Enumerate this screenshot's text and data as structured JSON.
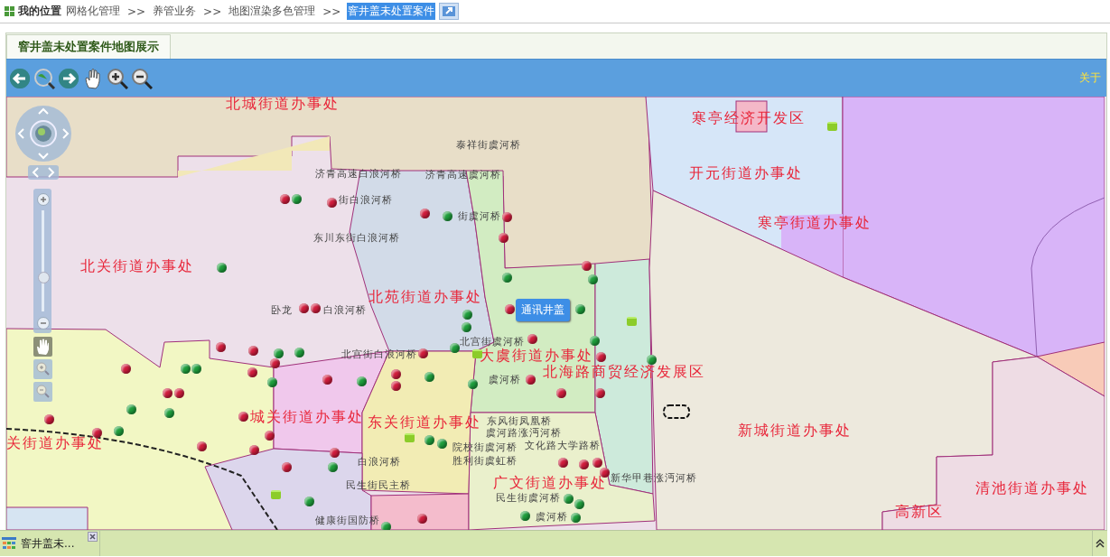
{
  "breadcrumb": {
    "label": "我的位置",
    "items": [
      {
        "text": "网格化管理",
        "selected": false
      },
      {
        "text": "养管业务",
        "separator": ">>",
        "selected": false
      },
      {
        "text": "地图渲染多色管理",
        "separator": ">>",
        "selected": false
      },
      {
        "text": "窨井盖未处置案件",
        "separator": ">>",
        "selected": true
      }
    ]
  },
  "tabs": [
    {
      "label": "窨井盖未处置案件地图展示",
      "selected": true
    }
  ],
  "toolbar": {
    "about": "关于"
  },
  "map": {
    "zoom": {
      "level": 0.35
    },
    "nav_tools": [
      {
        "kind": "pan",
        "selected": true
      },
      {
        "kind": "zoom_in",
        "selected": false
      },
      {
        "kind": "zoom_out",
        "selected": false
      }
    ],
    "regions": [
      "北城街道办事处",
      "寒亭经济开发区",
      "开元街道办事处",
      "寒亭街道办事处",
      "北关街道办事处",
      "北苑街道办事处",
      "大虞街道办事处",
      "北海路商贸经济发展区",
      "新城街道办事处",
      "城关街道办事处",
      "东关街道办事处",
      "关街道办事处",
      "广文街道办事处",
      "清池街道办事处",
      "高新区"
    ],
    "roads": [
      "泰祥街虞河桥",
      "济青高速白浪河桥",
      "济青高速虞河桥",
      "街白浪河桥",
      "东川东街白浪河桥",
      "街虞河桥",
      "卧龙",
      "白浪河桥",
      "北宫街虞河桥",
      "北宫街白浪河桥",
      "虞河桥",
      "东风街凤凰桥",
      "虞河路涨沔河桥",
      "院校街虞河桥",
      "文化路大学路桥",
      "胜利街虞虹桥",
      "新华甲巷涨沔河桥",
      "白浪河桥",
      "民生街民主桥",
      "民生街虞河桥",
      "虞河桥",
      "健康街国防桥"
    ],
    "markers": [
      {
        "kind": "case",
        "color": "#d01c3c"
      },
      {
        "kind": "case",
        "color": "#d01c3c"
      },
      {
        "kind": "case",
        "color": "#d01c3c"
      },
      {
        "kind": "case",
        "color": "#d01c3c"
      },
      {
        "kind": "case",
        "color": "#d01c3c"
      },
      {
        "kind": "case",
        "color": "#d01c3c"
      },
      {
        "kind": "case",
        "color": "#d01c3c"
      },
      {
        "kind": "case",
        "color": "#d01c3c"
      },
      {
        "kind": "case",
        "color": "#d01c3c"
      },
      {
        "kind": "case",
        "color": "#d01c3c"
      },
      {
        "kind": "case",
        "color": "#d01c3c"
      },
      {
        "kind": "case",
        "color": "#d01c3c"
      },
      {
        "kind": "case",
        "color": "#d01c3c"
      },
      {
        "kind": "case",
        "color": "#d01c3c"
      },
      {
        "kind": "case",
        "color": "#d01c3c"
      },
      {
        "kind": "case",
        "color": "#d01c3c"
      },
      {
        "kind": "case",
        "color": "#d01c3c"
      },
      {
        "kind": "case",
        "color": "#d01c3c"
      },
      {
        "kind": "case",
        "color": "#d01c3c"
      },
      {
        "kind": "case",
        "color": "#d01c3c"
      },
      {
        "kind": "case",
        "color": "#d01c3c"
      },
      {
        "kind": "case",
        "color": "#d01c3c"
      },
      {
        "kind": "case",
        "color": "#d01c3c"
      },
      {
        "kind": "case",
        "color": "#d01c3c"
      },
      {
        "kind": "case",
        "color": "#d01c3c"
      },
      {
        "kind": "case",
        "color": "#d01c3c"
      },
      {
        "kind": "case",
        "color": "#d01c3c"
      },
      {
        "kind": "case",
        "color": "#d01c3c"
      },
      {
        "kind": "case",
        "color": "#d01c3c"
      },
      {
        "kind": "case",
        "color": "#d01c3c"
      },
      {
        "kind": "case",
        "color": "#d01c3c"
      },
      {
        "kind": "case",
        "color": "#d01c3c"
      },
      {
        "kind": "case",
        "color": "#d01c3c"
      },
      {
        "kind": "case",
        "color": "#d01c3c"
      },
      {
        "kind": "case",
        "color": "#d01c3c"
      },
      {
        "kind": "case",
        "color": "#d01c3c"
      },
      {
        "kind": "case",
        "color": "#d01c3c"
      },
      {
        "kind": "case",
        "color": "#d01c3c"
      },
      {
        "kind": "case",
        "color": "#1e9e3c"
      },
      {
        "kind": "case",
        "color": "#1e9e3c"
      },
      {
        "kind": "case",
        "color": "#1e9e3c"
      },
      {
        "kind": "case",
        "color": "#1e9e3c"
      },
      {
        "kind": "case",
        "color": "#1e9e3c"
      },
      {
        "kind": "case",
        "color": "#1e9e3c"
      },
      {
        "kind": "case",
        "color": "#1e9e3c"
      },
      {
        "kind": "case",
        "color": "#1e9e3c"
      },
      {
        "kind": "case",
        "color": "#1e9e3c"
      },
      {
        "kind": "case",
        "color": "#1e9e3c"
      },
      {
        "kind": "case",
        "color": "#1e9e3c"
      },
      {
        "kind": "case",
        "color": "#1e9e3c"
      },
      {
        "kind": "case",
        "color": "#1e9e3c"
      },
      {
        "kind": "case",
        "color": "#1e9e3c"
      },
      {
        "kind": "case",
        "color": "#1e9e3c"
      },
      {
        "kind": "case",
        "color": "#1e9e3c"
      },
      {
        "kind": "case",
        "color": "#1e9e3c"
      },
      {
        "kind": "case",
        "color": "#1e9e3c"
      },
      {
        "kind": "case",
        "color": "#1e9e3c"
      },
      {
        "kind": "case",
        "color": "#1e9e3c"
      },
      {
        "kind": "case",
        "color": "#1e9e3c"
      },
      {
        "kind": "case",
        "color": "#1e9e3c"
      },
      {
        "kind": "case",
        "color": "#1e9e3c"
      },
      {
        "kind": "case",
        "color": "#1e9e3c"
      },
      {
        "kind": "case",
        "color": "#1e9e3c"
      },
      {
        "kind": "case",
        "color": "#1e9e3c"
      },
      {
        "kind": "case",
        "color": "#1e9e3c"
      },
      {
        "kind": "case",
        "color": "#1e9e3c"
      },
      {
        "kind": "case",
        "color": "#1e9e3c"
      },
      {
        "kind": "case",
        "color": "#1e9e3c"
      },
      {
        "kind": "case",
        "color": "#1e9e3c"
      },
      {
        "kind": "well",
        "color": "#8ccc2a"
      },
      {
        "kind": "well",
        "color": "#8ccc2a"
      },
      {
        "kind": "well",
        "color": "#8ccc2a"
      },
      {
        "kind": "well",
        "color": "#8ccc2a"
      },
      {
        "kind": "well",
        "color": "#8ccc2a"
      }
    ],
    "popup": "通讯井盖"
  },
  "taskbar": {
    "items": [
      {
        "label": "窨井盖未..."
      }
    ]
  }
}
